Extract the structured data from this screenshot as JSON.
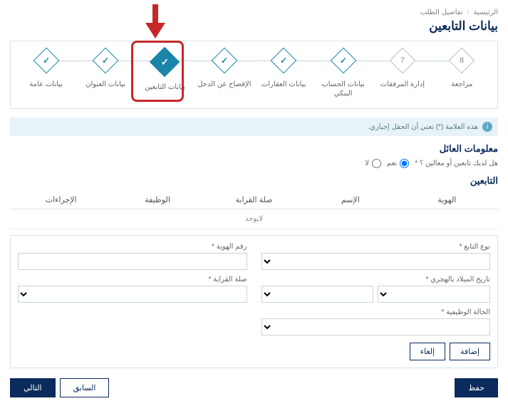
{
  "breadcrumb": {
    "home": "الرئيسية",
    "sep": "›",
    "current": "تفاصيل الطلب"
  },
  "page_title": "بيانات التابعين",
  "steps": [
    {
      "label": "بيانات عامة",
      "state": "done"
    },
    {
      "label": "بيانات العنوان",
      "state": "done"
    },
    {
      "label": "بيانات التابعين",
      "state": "active"
    },
    {
      "label": "الإفصاح عن الدخل",
      "state": "done"
    },
    {
      "label": "بيانات العقارات",
      "state": "done"
    },
    {
      "label": "بيانات الحساب البنكي",
      "state": "done"
    },
    {
      "label": "إدارة المرفقات",
      "state": "num",
      "num": "7"
    },
    {
      "label": "مراجعة",
      "state": "num",
      "num": "8"
    }
  ],
  "alert_text": "هذه العلامة (*) تعني أن الحقل إجباري.",
  "section1_title": "معلومات العائل",
  "radio_question": "هل لديك تابعين أو معالين ؟ *",
  "radio_yes": "نعم",
  "radio_no": "لا",
  "section2_title": "التابعين",
  "table_headers": {
    "id": "الهوية",
    "name": "الإسم",
    "relation": "صلة القرابة",
    "job": "الوظيفة",
    "actions": "الإجراءات"
  },
  "empty_text": "لايوجد",
  "fields": {
    "type": "نوع التابع *",
    "id_number": "رقم الهوية *",
    "dob": "تاريخ الميلاد بالهجري *",
    "relation": "صلة القرابة *",
    "job_status": "الحالة الوظيفية *"
  },
  "btn_add": "إضافة",
  "btn_cancel": "إلغاء",
  "btn_save": "حفظ",
  "btn_prev": "السابق",
  "btn_next": "التالي"
}
